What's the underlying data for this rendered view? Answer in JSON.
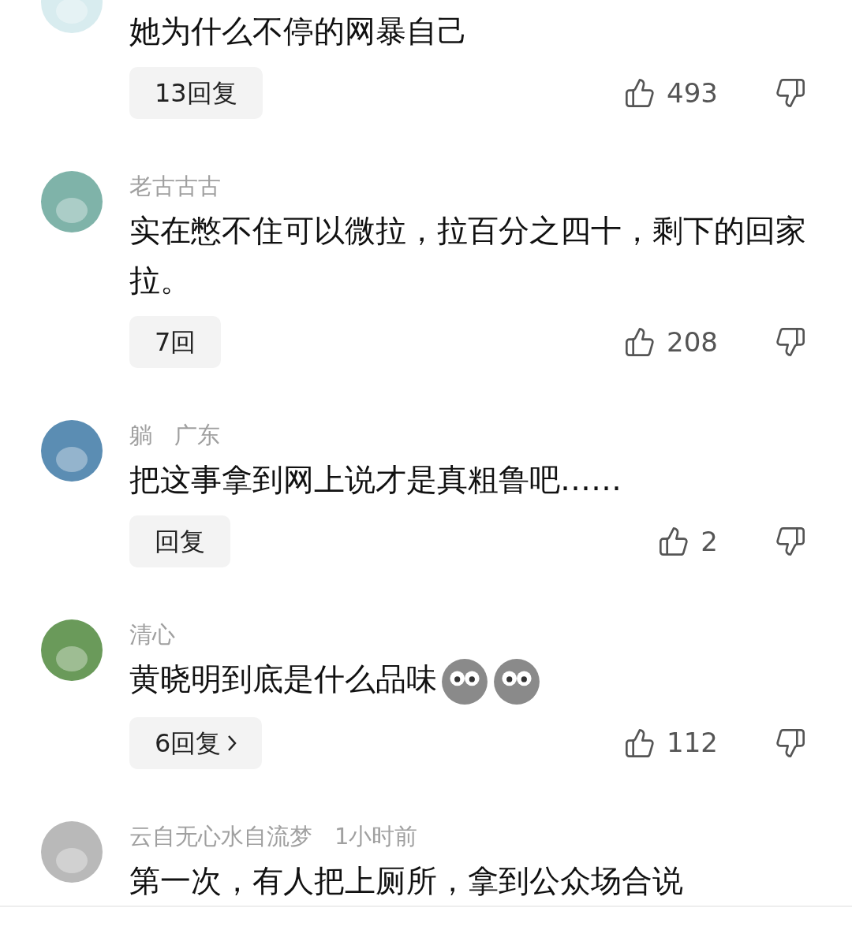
{
  "comments": [
    {
      "text": "她为什么不停的网暴自己",
      "replies": {
        "label": "13回复",
        "chevron": false
      },
      "likes": "493"
    },
    {
      "meta": [
        "老古古古"
      ],
      "text": "实在憋不住可以微拉，拉百分之四十，剩下的回家拉。",
      "replies": {
        "label": "7回",
        "chevron": false
      },
      "likes": "208"
    },
    {
      "meta": [
        "躺",
        "广东"
      ],
      "text": "把这事拿到网上说才是真粗鲁吧……",
      "replies": {
        "label": "回复",
        "chevron": false
      },
      "likes": "2"
    },
    {
      "meta": [
        "清心"
      ],
      "text": "黄晓明到底是什么品味",
      "emojis": [
        {
          "kind": "shocked"
        },
        {
          "kind": "shocked"
        }
      ],
      "replies": {
        "label": "6回复",
        "chevron": true
      },
      "likes": "112"
    },
    {
      "meta": [
        "云自无心水自流梦",
        "1小时前"
      ],
      "text": "第一次，有人把上厕所，拿到公众场合说"
    }
  ]
}
